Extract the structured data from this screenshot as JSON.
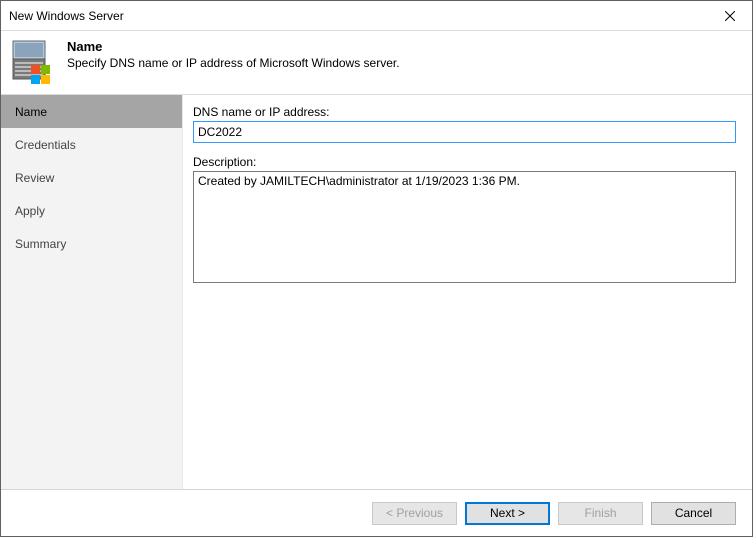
{
  "window": {
    "title": "New Windows Server"
  },
  "header": {
    "title": "Name",
    "subtitle": "Specify DNS name or IP address of Microsoft Windows server."
  },
  "sidebar": {
    "items": [
      {
        "label": "Name"
      },
      {
        "label": "Credentials"
      },
      {
        "label": "Review"
      },
      {
        "label": "Apply"
      },
      {
        "label": "Summary"
      }
    ]
  },
  "form": {
    "dns_label": "DNS name or IP address:",
    "dns_value": "DC2022",
    "desc_label": "Description:",
    "desc_value": "Created by JAMILTECH\\administrator at 1/19/2023 1:36 PM."
  },
  "footer": {
    "prev": "< Previous",
    "next": "Next >",
    "finish": "Finish",
    "cancel": "Cancel"
  }
}
